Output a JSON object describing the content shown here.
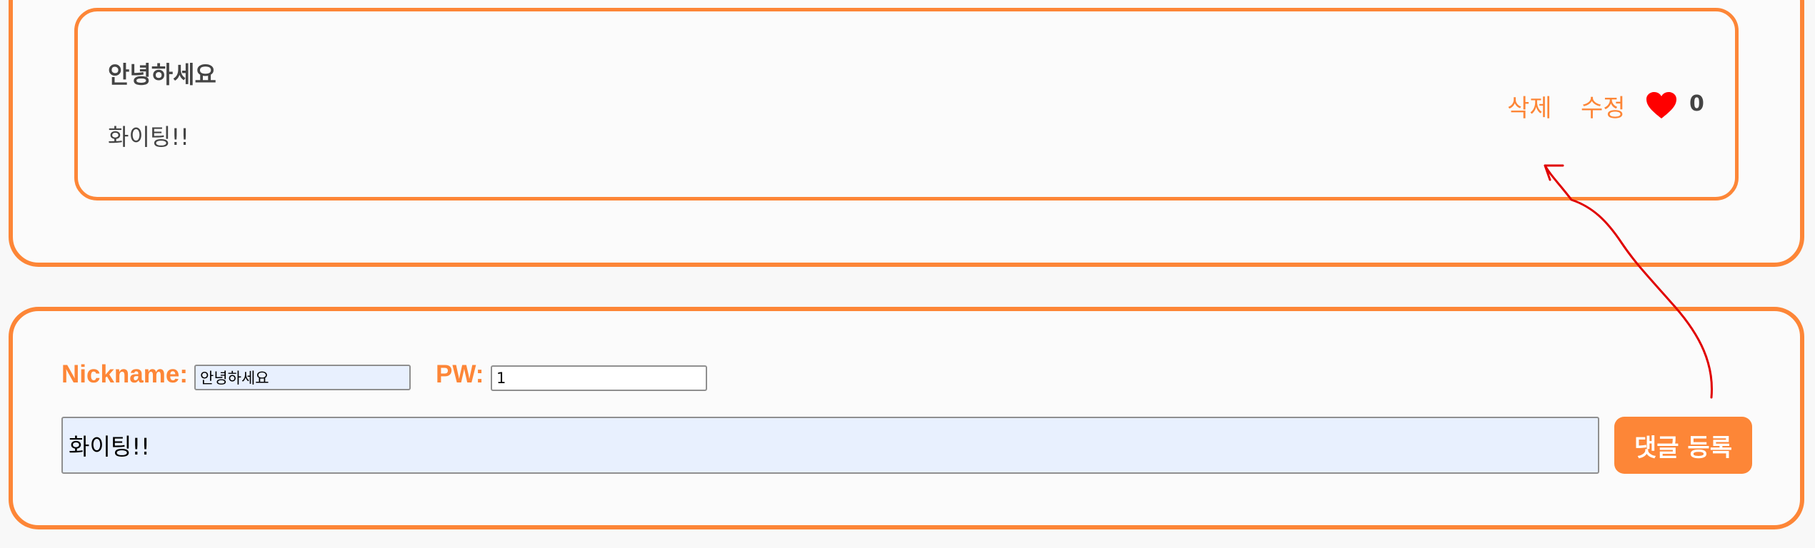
{
  "comment": {
    "nickname": "안녕하세요",
    "content": "화이팅!!",
    "delete_label": "삭제",
    "edit_label": "수정",
    "like_count": "0"
  },
  "form": {
    "nickname_label": "Nickname:",
    "nickname_value": "안녕하세요",
    "pw_label": "PW:",
    "pw_value": "1",
    "content_value": "화이팅!!",
    "submit_label": "댓글 등록"
  },
  "colors": {
    "accent": "#fd8637",
    "heart": "#ff0000",
    "autofill": "#e8f0fe",
    "annotation": "#e00000"
  },
  "icons": {
    "like": "heart-icon",
    "annotation": "arrow-annotation"
  }
}
